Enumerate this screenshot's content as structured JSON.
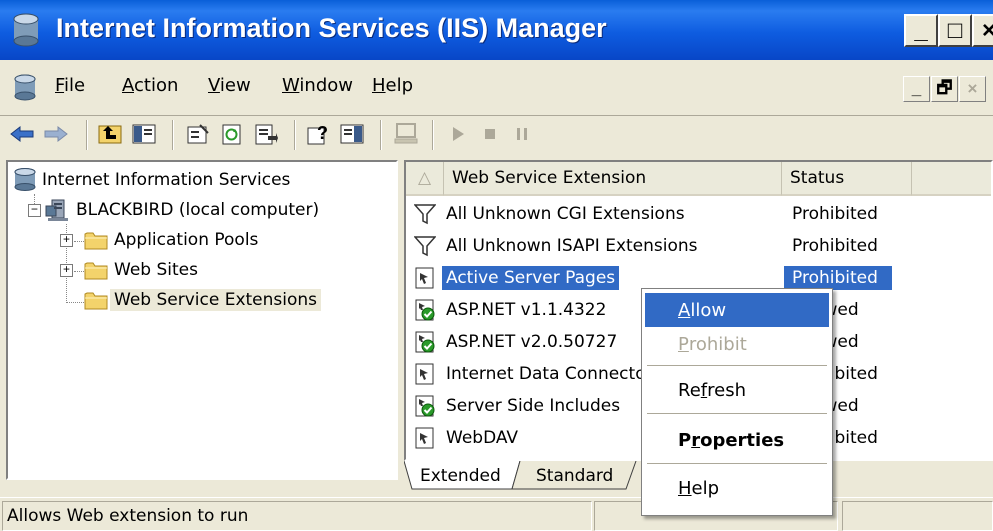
{
  "window": {
    "title": "Internet Information Services (IIS) Manager",
    "caption_buttons": [
      "_",
      "□",
      "×"
    ]
  },
  "menubar": {
    "items": [
      {
        "label": "File",
        "mnemonic": "F"
      },
      {
        "label": "Action",
        "mnemonic": "A"
      },
      {
        "label": "View",
        "mnemonic": "V"
      },
      {
        "label": "Window",
        "mnemonic": "W"
      },
      {
        "label": "Help",
        "mnemonic": "H"
      }
    ],
    "mdi_buttons": [
      "_",
      "🗗",
      "×"
    ]
  },
  "toolbar": {
    "icons": [
      "back-icon",
      "forward-icon",
      "up-level-icon",
      "show-hide-tree-icon",
      "properties-icon",
      "refresh-icon",
      "export-list-icon",
      "help-icon",
      "show-action-pane-icon",
      "computer-icon",
      "play-icon",
      "stop-icon",
      "pause-icon"
    ]
  },
  "tree": {
    "root": "Internet Information Services",
    "computer": "BLACKBIRD (local computer)",
    "children": [
      {
        "label": "Application Pools",
        "expander": "+"
      },
      {
        "label": "Web Sites",
        "expander": "+"
      },
      {
        "label": "Web Service Extensions",
        "expander": ""
      }
    ],
    "computer_expander": "−"
  },
  "list": {
    "sort_arrow": "△",
    "columns": [
      "Web Service Extension",
      "Status"
    ],
    "rows": [
      {
        "name": "All Unknown CGI Extensions",
        "status": "Prohibited",
        "icon": "filter-icon"
      },
      {
        "name": "All Unknown ISAPI Extensions",
        "status": "Prohibited",
        "icon": "filter-icon"
      },
      {
        "name": "Active Server Pages",
        "status": "Prohibited",
        "icon": "extension-icon"
      },
      {
        "name": "ASP.NET v1.1.4322",
        "status": "Allowed",
        "icon": "extension-allowed-icon"
      },
      {
        "name": "ASP.NET v2.0.50727",
        "status": "Allowed",
        "icon": "extension-allowed-icon"
      },
      {
        "name": "Internet Data Connector",
        "status": "Prohibited",
        "icon": "extension-icon"
      },
      {
        "name": "Server Side Includes",
        "status": "Allowed",
        "icon": "extension-allowed-icon"
      },
      {
        "name": "WebDAV",
        "status": "Prohibited",
        "icon": "extension-icon"
      }
    ],
    "selected_row": 2
  },
  "tabs": [
    {
      "label": "Extended"
    },
    {
      "label": "Standard"
    }
  ],
  "statusbar": {
    "text": "Allows Web extension to run"
  },
  "context_menu": {
    "items": [
      {
        "label": "Allow",
        "mnemonic": "A",
        "state": "highlighted"
      },
      {
        "label": "Prohibit",
        "mnemonic": "P",
        "state": "disabled"
      },
      {
        "label": "Refresh",
        "mnemonic": "f",
        "state": "normal"
      },
      {
        "label": "Properties",
        "mnemonic": "r",
        "state": "bold"
      },
      {
        "label": "Help",
        "mnemonic": "H",
        "state": "normal"
      }
    ]
  },
  "colors": {
    "titlebar": "#0a5fd8",
    "selection": "#316ac5",
    "chrome": "#ece9d8",
    "folder": "#f3d36b",
    "check": "#2a9a2a"
  }
}
